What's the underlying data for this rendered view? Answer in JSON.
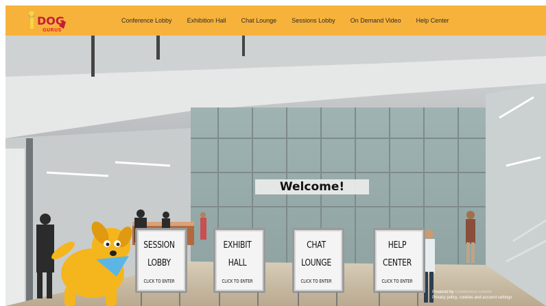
{
  "brand": {
    "logo_text_top": "DOG",
    "logo_text_bottom": "GURUS"
  },
  "nav": {
    "items": [
      {
        "label": "Conference Lobby"
      },
      {
        "label": "Exhibition Hall"
      },
      {
        "label": "Chat Lounge"
      },
      {
        "label": "Sessions Lobby"
      },
      {
        "label": "On Demand Video"
      },
      {
        "label": "Help Center"
      }
    ]
  },
  "lobby": {
    "welcome": "Welcome!",
    "signs": [
      {
        "line1": "SESSION",
        "line2": "LOBBY",
        "cta": "CLICK TO ENTER"
      },
      {
        "line1": "EXHIBIT",
        "line2": "HALL",
        "cta": "CLICK TO ENTER"
      },
      {
        "line1": "CHAT",
        "line2": "LOUNGE",
        "cta": "CLICK TO ENTER"
      },
      {
        "line1": "HELP",
        "line2": "CENTER",
        "cta": "CLICK TO ENTER"
      }
    ]
  },
  "footer": {
    "powered_by": "Powered by",
    "brand_name": "Conference Online",
    "privacy": "Privacy policy, cookies and account settings"
  },
  "colors": {
    "navbar": "#f7b23b",
    "mascot": "#f5b51c",
    "bandana": "#5bb6e6"
  }
}
